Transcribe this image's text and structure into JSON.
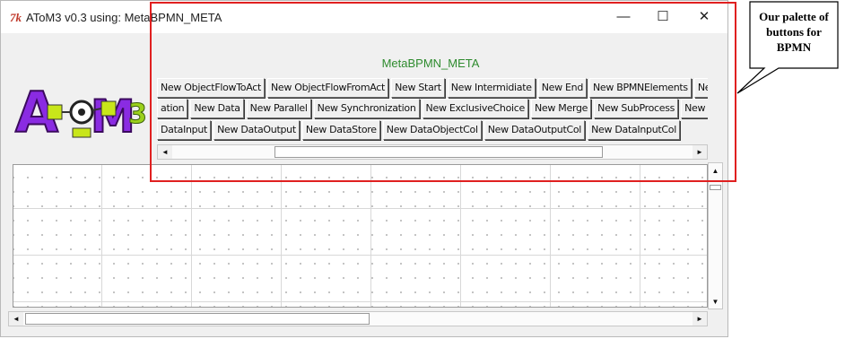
{
  "window": {
    "tk_icon": "7k",
    "title": "AToM3 v0.3 using: MetaBPMN_META",
    "controls": {
      "minimize": "—",
      "maximize": "☐",
      "close": "✕"
    }
  },
  "logo": {
    "text": "AToM3"
  },
  "palette": {
    "title": "MetaBPMN_META",
    "row1": [
      "New ObjectFlowToAct",
      "New ObjectFlowFromAct",
      "New Start",
      "New Intermidiate",
      "New End",
      "New BPMNElements",
      "New Swimlan"
    ],
    "row2": [
      "ation",
      "New Data",
      "New Parallel",
      "New Synchronization",
      "New ExclusiveChoice",
      "New Merge",
      "New SubProcess",
      "New FlowObjec"
    ],
    "row3": [
      "DataInput",
      "New DataOutput",
      "New DataStore",
      "New DataObjectCol",
      "New DataOutputCol",
      "New DataInputCol"
    ]
  },
  "scroll": {
    "left_arrow": "◄",
    "right_arrow": "►",
    "up_arrow": "▲",
    "down_arrow": "▼"
  },
  "annotation": {
    "callout_text": "Our palette of buttons for BPMN",
    "highlight_color": "#e02020"
  },
  "colors": {
    "palette_title": "#2e8b2e"
  }
}
